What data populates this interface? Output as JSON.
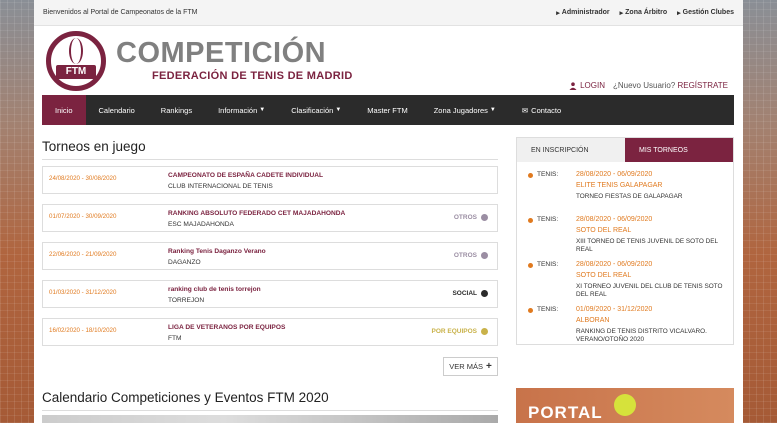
{
  "topbar": {
    "welcome": "Bienvenidos al Portal de Campeonatos de la FTM",
    "links": [
      {
        "label": "Administrador",
        "icon": "triangle-right-icon"
      },
      {
        "label": "Zona Árbitro",
        "icon": "triangle-right-icon"
      },
      {
        "label": "Gestión Clubes",
        "icon": "triangle-right-icon"
      }
    ]
  },
  "brand": {
    "logo_text": "FTM",
    "title": "COMPETICIÓN",
    "subtitle": "FEDERACIÓN DE TENIS DE MADRID",
    "color": "#7b2340"
  },
  "user": {
    "login": "LOGIN",
    "new_user": "¿Nuevo Usuario?",
    "register": "REGÍSTRATE"
  },
  "nav": {
    "items": [
      {
        "label": "Inicio",
        "active": true
      },
      {
        "label": "Calendario"
      },
      {
        "label": "Rankings"
      },
      {
        "label": "Información",
        "dropdown": true
      },
      {
        "label": "Clasificación",
        "dropdown": true
      },
      {
        "label": "Master FTM"
      },
      {
        "label": "Zona Jugadores",
        "dropdown": true
      },
      {
        "label": "Contacto",
        "icon": "envelope-icon"
      }
    ]
  },
  "torneos": {
    "title": "Torneos en juego",
    "items": [
      {
        "date": "24/08/2020 - 30/08/2020",
        "name": "CAMPEONATO DE ESPAÑA CADETE INDIVIDUAL",
        "club": "CLUB INTERNACIONAL DE TENIS",
        "category": "",
        "cat_color": ""
      },
      {
        "date": "01/07/2020 - 30/09/2020",
        "name": "RANKING ABSOLUTO FEDERADO CET MAJADAHONDA",
        "club": "ESC MAJADAHONDA",
        "category": "OTROS",
        "cat_color": "#9b8ea3"
      },
      {
        "date": "22/06/2020 - 21/09/2020",
        "name": "Ranking Tenis Daganzo Verano",
        "club": "DAGANZO",
        "category": "OTROS",
        "cat_color": "#9b8ea3"
      },
      {
        "date": "01/03/2020 - 31/12/2020",
        "name": "ranking club de tenis torrejon",
        "club": "TORREJON",
        "category": "SOCIAL",
        "cat_color": "#2b2b2b"
      },
      {
        "date": "16/02/2020 - 18/10/2020",
        "name": "LIGA DE VETERANOS POR EQUIPOS",
        "club": "FTM",
        "category": "POR EQUIPOS",
        "cat_color": "#c9b24a"
      }
    ],
    "more": "VER MÁS"
  },
  "calendario": {
    "title": "Calendario Competiciones y Eventos FTM 2020"
  },
  "panel": {
    "tabs": [
      "EN INSCRIPCIÓN",
      "MIS TORNEOS"
    ],
    "items": [
      {
        "sport": "TENIS:",
        "date": "28/08/2020 - 06/09/2020",
        "name": "ELITE TENIS GALAPAGAR",
        "desc": "TORNEO FIESTAS DE GALAPAGAR"
      },
      {
        "sport": "TENIS:",
        "date": "28/08/2020 - 06/09/2020",
        "name": "SOTO DEL REAL",
        "desc": "XIII TORNEO DE TENIS JUVENIL DE SOTO DEL REAL"
      },
      {
        "sport": "TENIS:",
        "date": "28/08/2020 - 06/09/2020",
        "name": "SOTO DEL REAL",
        "desc": "XI TORNEO JUVENIL DEL CLUB DE TENIS SOTO DEL REAL"
      },
      {
        "sport": "TENIS:",
        "date": "01/09/2020 - 31/12/2020",
        "name": "ALBORAN",
        "desc": "RANKING DE TENIS DISTRITO VICALVARO. VERANO/OTOÑO 2020"
      }
    ]
  },
  "portal": {
    "text": "PORTAL"
  }
}
